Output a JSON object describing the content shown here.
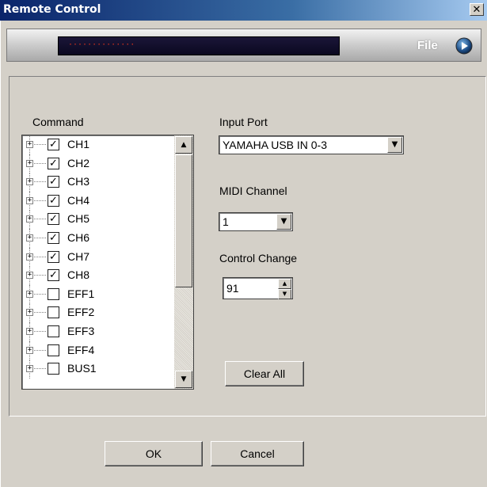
{
  "window": {
    "title": "Remote Control",
    "close_symbol": "✕"
  },
  "toolbar": {
    "display_text": "··············",
    "file_label": "File",
    "file_icon": "play-circle-icon"
  },
  "command": {
    "label": "Command",
    "items": [
      {
        "label": "CH1",
        "checked": true
      },
      {
        "label": "CH2",
        "checked": true
      },
      {
        "label": "CH3",
        "checked": true
      },
      {
        "label": "CH4",
        "checked": true
      },
      {
        "label": "CH5",
        "checked": true
      },
      {
        "label": "CH6",
        "checked": true
      },
      {
        "label": "CH7",
        "checked": true
      },
      {
        "label": "CH8",
        "checked": true
      },
      {
        "label": "EFF1",
        "checked": false
      },
      {
        "label": "EFF2",
        "checked": false
      },
      {
        "label": "EFF3",
        "checked": false
      },
      {
        "label": "EFF4",
        "checked": false
      },
      {
        "label": "BUS1",
        "checked": false
      }
    ]
  },
  "input_port": {
    "label": "Input Port",
    "value": "YAMAHA USB IN 0-3"
  },
  "midi_channel": {
    "label": "MIDI Channel",
    "value": "1"
  },
  "control_change": {
    "label": "Control Change",
    "value": "91"
  },
  "buttons": {
    "clear_all": "Clear All",
    "ok": "OK",
    "cancel": "Cancel"
  },
  "colors": {
    "title_bar": "#0a246a",
    "face": "#d4d0c8",
    "display": "#0a0820",
    "display_text": "#e0341c"
  }
}
